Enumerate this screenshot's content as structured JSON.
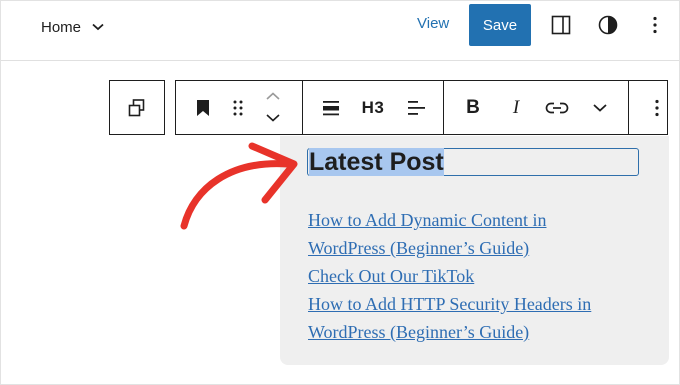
{
  "header": {
    "home_label": "Home",
    "view_label": "View",
    "save_label": "Save"
  },
  "toolbar": {
    "heading_level": "H3"
  },
  "content": {
    "title": "Latest Post",
    "posts": [
      "How to Add Dynamic Content in",
      "WordPress (Beginner’s Guide)",
      "Check Out Our TikTok",
      "How to Add HTTP Security Headers in",
      "WordPress (Beginner’s Guide)"
    ]
  },
  "colors": {
    "accent": "#2271b1",
    "link": "#2e6db3",
    "selection": "#a8c7ef",
    "annotation_arrow": "#e8332a"
  }
}
